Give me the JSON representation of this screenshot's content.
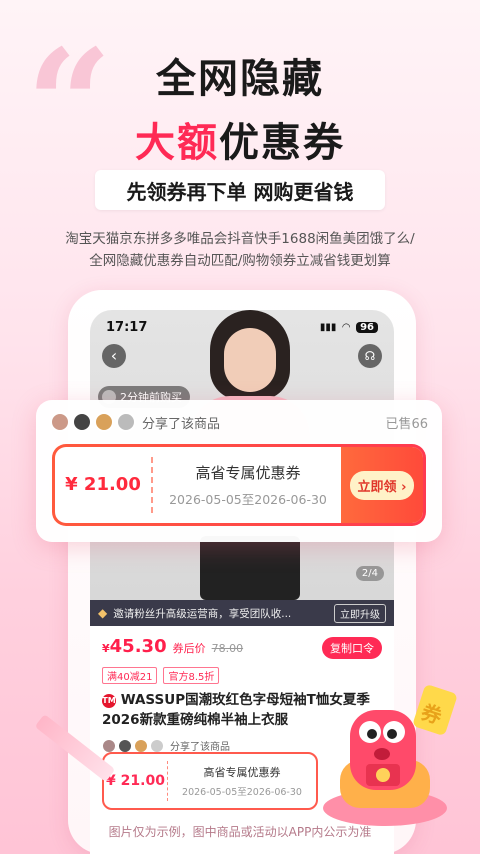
{
  "headline": {
    "line1": "全网隐藏",
    "line2_red": "大额",
    "line2_black": "优惠券"
  },
  "ribbon": "先领券再下单  网购更省钱",
  "subtitle": {
    "line1": "淘宝天猫京东拼多多唯品会抖音快手1688闲鱼美团饿了么/",
    "line2": "全网隐藏优惠券自动匹配/购物领券立减省钱更划算"
  },
  "phone": {
    "time": "17:17",
    "signal": "▮▮▮",
    "wifi": "◠",
    "battery": "96",
    "back_icon": "‹",
    "service_icon": "☊",
    "flash_text": "2分钟前购买",
    "pager": "2/4",
    "invite": {
      "text": "邀请粉丝升高级运营商，享受团队收...",
      "upgrade": "立即升级",
      "gem": "◆"
    },
    "product": {
      "currency": "¥",
      "price": "45.30",
      "after_label": "券后价",
      "orig_price": "78.00",
      "copy_btn": "复制口令",
      "tags": [
        "满40减21",
        "官方8.5折"
      ],
      "tm_badge": "TM",
      "title": "WASSUP国潮玫红色字母短袖T恤女夏季2026新款重磅纯棉半袖上衣服",
      "shared": "分享了该商品"
    },
    "mini_coupon": {
      "price": "¥ 21.00",
      "title": "高省专属优惠券",
      "date": "2026-05-05至2026-06-30"
    }
  },
  "share_card": {
    "shared_text": "分享了该商品",
    "sold": "已售66",
    "coupon": {
      "price": "¥ 21.00",
      "title": "高省专属优惠券",
      "date": "2026-05-05至2026-06-30",
      "claim": "立即领 ›"
    }
  },
  "mascot_sign": "券",
  "footer": "图片仅为示例，图中商品或活动以APP内公示为准",
  "colors": {
    "accent": "#ff2a55",
    "coupon": "#ff4a3a"
  }
}
